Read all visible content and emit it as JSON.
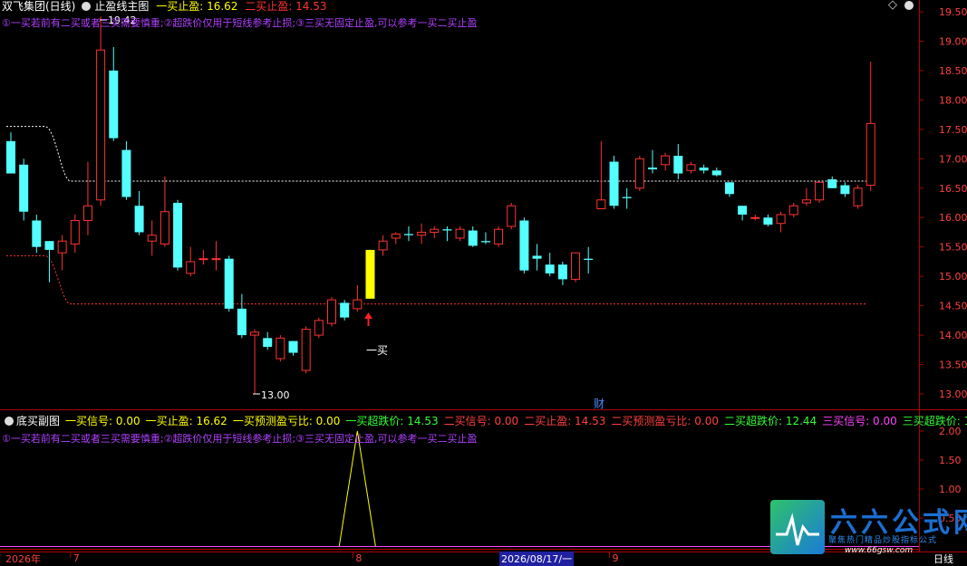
{
  "main_panel": {
    "title": "双飞集团(日线)",
    "indicator_name": "止盈线主图",
    "buy1_stop_label": "一买止盈: 16.62",
    "buy2_stop_label": "二买止盈: 14.53",
    "note": "①一买若前有二买或者三买需要慎重;②超跌价仅用于短线参考止损;③三买无固定止盈,可以参考一买二买止盈",
    "high_label": "19.42",
    "low_label": "13.00",
    "buy_marker_label": "一买",
    "cai_label": "财",
    "diamond_icon": "◇"
  },
  "sub_panel": {
    "title": "底买副图",
    "items": [
      {
        "text": "一买信号: 0.00",
        "color": "#ffff00"
      },
      {
        "text": "一买止盈: 16.62",
        "color": "#ffff00"
      },
      {
        "text": "一买预测盈亏比: 0.00",
        "color": "#ffff00"
      },
      {
        "text": "一买超跌价: 14.53",
        "color": "#33ff33"
      },
      {
        "text": "二买信号: 0.00",
        "color": "#ff4040"
      },
      {
        "text": "二买止盈: 14.53",
        "color": "#ff4040"
      },
      {
        "text": "二买预测盈亏比: 0.00",
        "color": "#ff4040"
      },
      {
        "text": "二买超跌价: 12.44",
        "color": "#33ff33"
      },
      {
        "text": "三买信号: 0.00",
        "color": "#ff44ff"
      },
      {
        "text": "三买超跌价: 1",
        "color": "#33ff33"
      }
    ],
    "note": "①一买若前有二买或者三买需要慎重;②超跌价仅用于短线参考止损;③三买无固定止盈,可以参考一买二买止盈"
  },
  "date_axis": {
    "year": "2026年",
    "labels": [
      {
        "text": "7",
        "i": 5
      },
      {
        "text": "8",
        "i": 27
      },
      {
        "text": "9",
        "i": 47
      }
    ],
    "cursor_date": "2026/08/17/一",
    "period": "日线"
  },
  "watermark": {
    "name": "六六公式网",
    "slogan": "聚焦热门精品炒股指标公式",
    "url": "www.66gsw.com"
  },
  "colors": {
    "up": "#ff3232",
    "down": "#54ffff",
    "axis": "#b00000",
    "dotted_line": "#ffffff",
    "stop_line": "#ff3232",
    "buy_bar": "#ffff00",
    "signal_line": "#ffff00"
  },
  "chart_data": [
    {
      "type": "candlestick",
      "title": "双飞集团(日线)",
      "ylim": [
        12.8,
        19.6
      ],
      "y_ticks": [
        13.0,
        13.5,
        14.0,
        14.5,
        15.0,
        15.5,
        16.0,
        16.5,
        17.0,
        17.5,
        18.0,
        18.5,
        19.0,
        19.5
      ],
      "candles": [
        {
          "o": 17.3,
          "h": 17.45,
          "l": 16.8,
          "c": 16.75
        },
        {
          "o": 16.9,
          "h": 17.0,
          "l": 15.95,
          "c": 16.1
        },
        {
          "o": 15.95,
          "h": 16.05,
          "l": 15.4,
          "c": 15.5
        },
        {
          "o": 15.6,
          "h": 15.6,
          "l": 14.9,
          "c": 15.45
        },
        {
          "o": 15.4,
          "h": 15.7,
          "l": 15.1,
          "c": 15.6
        },
        {
          "o": 15.55,
          "h": 16.05,
          "l": 15.4,
          "c": 15.95
        },
        {
          "o": 15.95,
          "h": 16.95,
          "l": 15.7,
          "c": 16.2
        },
        {
          "o": 16.3,
          "h": 19.42,
          "l": 16.2,
          "c": 18.85
        },
        {
          "o": 18.5,
          "h": 18.9,
          "l": 17.3,
          "c": 17.35
        },
        {
          "o": 17.15,
          "h": 17.3,
          "l": 16.3,
          "c": 16.35
        },
        {
          "o": 16.2,
          "h": 16.45,
          "l": 15.7,
          "c": 15.75
        },
        {
          "o": 15.6,
          "h": 15.95,
          "l": 15.35,
          "c": 15.7
        },
        {
          "o": 15.55,
          "h": 16.7,
          "l": 15.5,
          "c": 16.1
        },
        {
          "o": 16.25,
          "h": 16.3,
          "l": 15.1,
          "c": 15.15
        },
        {
          "o": 15.05,
          "h": 15.5,
          "l": 15.0,
          "c": 15.25
        },
        {
          "o": 15.3,
          "h": 15.45,
          "l": 15.2,
          "c": 15.3
        },
        {
          "o": 15.3,
          "h": 15.6,
          "l": 15.1,
          "c": 15.3
        },
        {
          "o": 15.3,
          "h": 15.35,
          "l": 14.4,
          "c": 14.45
        },
        {
          "o": 14.45,
          "h": 14.7,
          "l": 13.95,
          "c": 14.0
        },
        {
          "o": 14.0,
          "h": 14.1,
          "l": 13.0,
          "c": 14.05
        },
        {
          "o": 13.95,
          "h": 14.05,
          "l": 13.75,
          "c": 13.8
        },
        {
          "o": 13.6,
          "h": 14.0,
          "l": 13.55,
          "c": 13.95
        },
        {
          "o": 13.9,
          "h": 13.9,
          "l": 13.65,
          "c": 13.7
        },
        {
          "o": 13.4,
          "h": 14.15,
          "l": 13.35,
          "c": 14.1
        },
        {
          "o": 14.0,
          "h": 14.3,
          "l": 13.95,
          "c": 14.25
        },
        {
          "o": 14.2,
          "h": 14.65,
          "l": 14.15,
          "c": 14.6
        },
        {
          "o": 14.55,
          "h": 14.6,
          "l": 14.25,
          "c": 14.3
        },
        {
          "o": 14.45,
          "h": 14.85,
          "l": 14.4,
          "c": 14.6
        },
        {
          "o": 14.62,
          "h": 15.45,
          "l": 14.62,
          "c": 15.45,
          "highlight": true
        },
        {
          "o": 15.45,
          "h": 15.7,
          "l": 15.35,
          "c": 15.6
        },
        {
          "o": 15.65,
          "h": 15.75,
          "l": 15.55,
          "c": 15.72
        },
        {
          "o": 15.72,
          "h": 15.85,
          "l": 15.6,
          "c": 15.7
        },
        {
          "o": 15.7,
          "h": 15.9,
          "l": 15.55,
          "c": 15.75
        },
        {
          "o": 15.75,
          "h": 15.85,
          "l": 15.65,
          "c": 15.8
        },
        {
          "o": 15.8,
          "h": 15.85,
          "l": 15.6,
          "c": 15.78
        },
        {
          "o": 15.65,
          "h": 15.85,
          "l": 15.6,
          "c": 15.8
        },
        {
          "o": 15.78,
          "h": 15.85,
          "l": 15.5,
          "c": 15.52
        },
        {
          "o": 15.6,
          "h": 15.75,
          "l": 15.55,
          "c": 15.58
        },
        {
          "o": 15.55,
          "h": 15.85,
          "l": 15.5,
          "c": 15.8
        },
        {
          "o": 15.85,
          "h": 16.25,
          "l": 15.8,
          "c": 16.2
        },
        {
          "o": 15.95,
          "h": 16.0,
          "l": 15.05,
          "c": 15.1
        },
        {
          "o": 15.35,
          "h": 15.55,
          "l": 15.1,
          "c": 15.3
        },
        {
          "o": 15.2,
          "h": 15.4,
          "l": 15.0,
          "c": 15.05
        },
        {
          "o": 15.2,
          "h": 15.25,
          "l": 14.85,
          "c": 14.95
        },
        {
          "o": 14.95,
          "h": 15.4,
          "l": 14.9,
          "c": 15.4
        },
        {
          "o": 15.3,
          "h": 15.5,
          "l": 15.05,
          "c": 15.28
        },
        {
          "o": 16.15,
          "h": 17.3,
          "l": 16.15,
          "c": 16.3
        },
        {
          "o": 16.95,
          "h": 17.05,
          "l": 16.15,
          "c": 16.2
        },
        {
          "o": 16.35,
          "h": 16.5,
          "l": 16.15,
          "c": 16.33
        },
        {
          "o": 16.5,
          "h": 17.05,
          "l": 16.45,
          "c": 17.0
        },
        {
          "o": 16.85,
          "h": 17.15,
          "l": 16.75,
          "c": 16.82
        },
        {
          "o": 16.9,
          "h": 17.1,
          "l": 16.8,
          "c": 17.05
        },
        {
          "o": 17.05,
          "h": 17.25,
          "l": 16.65,
          "c": 16.75
        },
        {
          "o": 16.8,
          "h": 16.95,
          "l": 16.75,
          "c": 16.9
        },
        {
          "o": 16.85,
          "h": 16.9,
          "l": 16.75,
          "c": 16.8
        },
        {
          "o": 16.8,
          "h": 16.85,
          "l": 16.7,
          "c": 16.72
        },
        {
          "o": 16.6,
          "h": 16.6,
          "l": 16.35,
          "c": 16.4
        },
        {
          "o": 16.2,
          "h": 16.2,
          "l": 15.95,
          "c": 16.05
        },
        {
          "o": 16.0,
          "h": 16.05,
          "l": 15.95,
          "c": 16.0
        },
        {
          "o": 16.0,
          "h": 16.05,
          "l": 15.85,
          "c": 15.88
        },
        {
          "o": 15.9,
          "h": 16.1,
          "l": 15.75,
          "c": 16.05
        },
        {
          "o": 16.05,
          "h": 16.25,
          "l": 16.0,
          "c": 16.2
        },
        {
          "o": 16.25,
          "h": 16.5,
          "l": 16.2,
          "c": 16.3
        },
        {
          "o": 16.3,
          "h": 16.6,
          "l": 16.25,
          "c": 16.6
        },
        {
          "o": 16.65,
          "h": 16.7,
          "l": 16.5,
          "c": 16.5
        },
        {
          "o": 16.55,
          "h": 16.6,
          "l": 16.35,
          "c": 16.4
        },
        {
          "o": 16.2,
          "h": 16.55,
          "l": 16.15,
          "c": 16.5
        },
        {
          "o": 16.55,
          "h": 18.65,
          "l": 16.45,
          "c": 17.6
        }
      ],
      "dotted_line": {
        "y_start": 17.55,
        "y_end": 16.62,
        "i_end": 67
      },
      "stop_line": {
        "y_start": 15.35,
        "y_end": 14.53,
        "i_end": 67
      }
    },
    {
      "type": "line",
      "title": "底买副图",
      "ylim": [
        0,
        2.2
      ],
      "y_ticks": [
        0.5,
        1.0,
        1.5,
        2.0
      ],
      "series": [
        {
          "values_index": [
            26,
            27,
            28
          ],
          "values": [
            0,
            2,
            0
          ]
        }
      ]
    }
  ]
}
